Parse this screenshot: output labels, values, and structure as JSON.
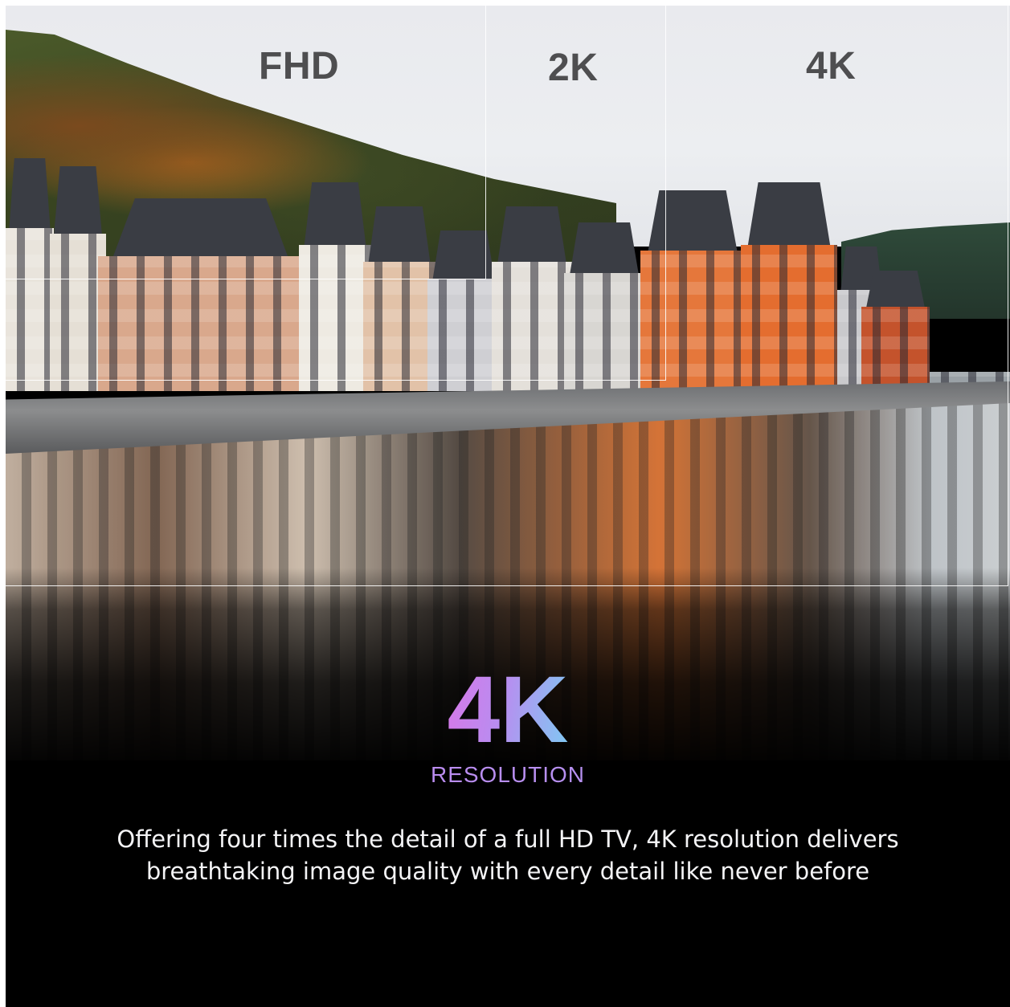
{
  "labels": {
    "fhd": "FHD",
    "two_k": "2K",
    "four_k": "4K"
  },
  "headline": {
    "big": "4K",
    "sub": "RESOLUTION"
  },
  "description": "Offering four times the detail of a full HD TV, 4K resolution delivers breathtaking image quality with every detail like never before",
  "colors": {
    "headline_gradient_start": "#d877e8",
    "headline_gradient_end": "#7fc9f2",
    "label_gray": "#4e4e50",
    "background": "#000000"
  }
}
